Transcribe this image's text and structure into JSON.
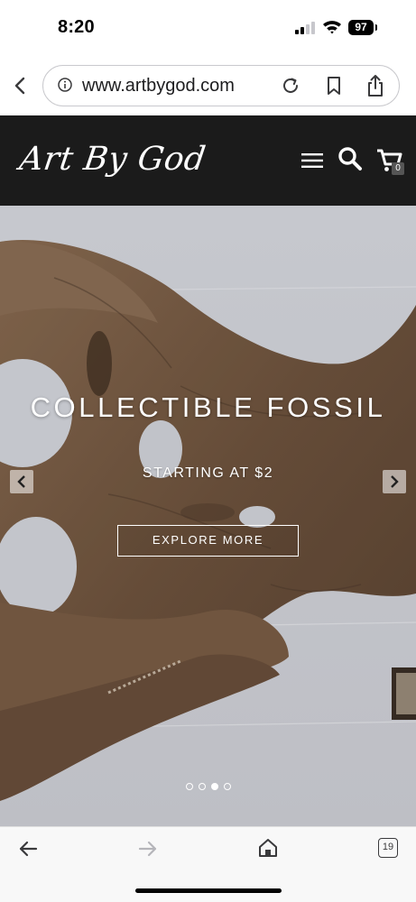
{
  "status_bar": {
    "time": "8:20",
    "battery": "97"
  },
  "browser": {
    "url": "www.artbygod.com",
    "tab_count": "19"
  },
  "site": {
    "logo_text": "Art By God",
    "cart_count": "0"
  },
  "hero": {
    "title": "COLLECTIBLE FOSSIL",
    "subtitle": "STARTING AT $2",
    "cta_label": "EXPLORE MORE",
    "slide_count": 4,
    "active_slide": 3
  },
  "colors": {
    "header_bg": "#1b1b1b",
    "hero_text": "#ffffff",
    "fossil": "#7a5d45"
  },
  "icons": [
    "back-chevron-icon",
    "info-icon",
    "reload-icon",
    "bookmark-icon",
    "share-icon",
    "menu-icon",
    "search-icon",
    "cart-icon",
    "chevron-left-icon",
    "chevron-right-icon",
    "arrow-left-icon",
    "arrow-right-icon",
    "home-icon",
    "tabs-icon"
  ]
}
